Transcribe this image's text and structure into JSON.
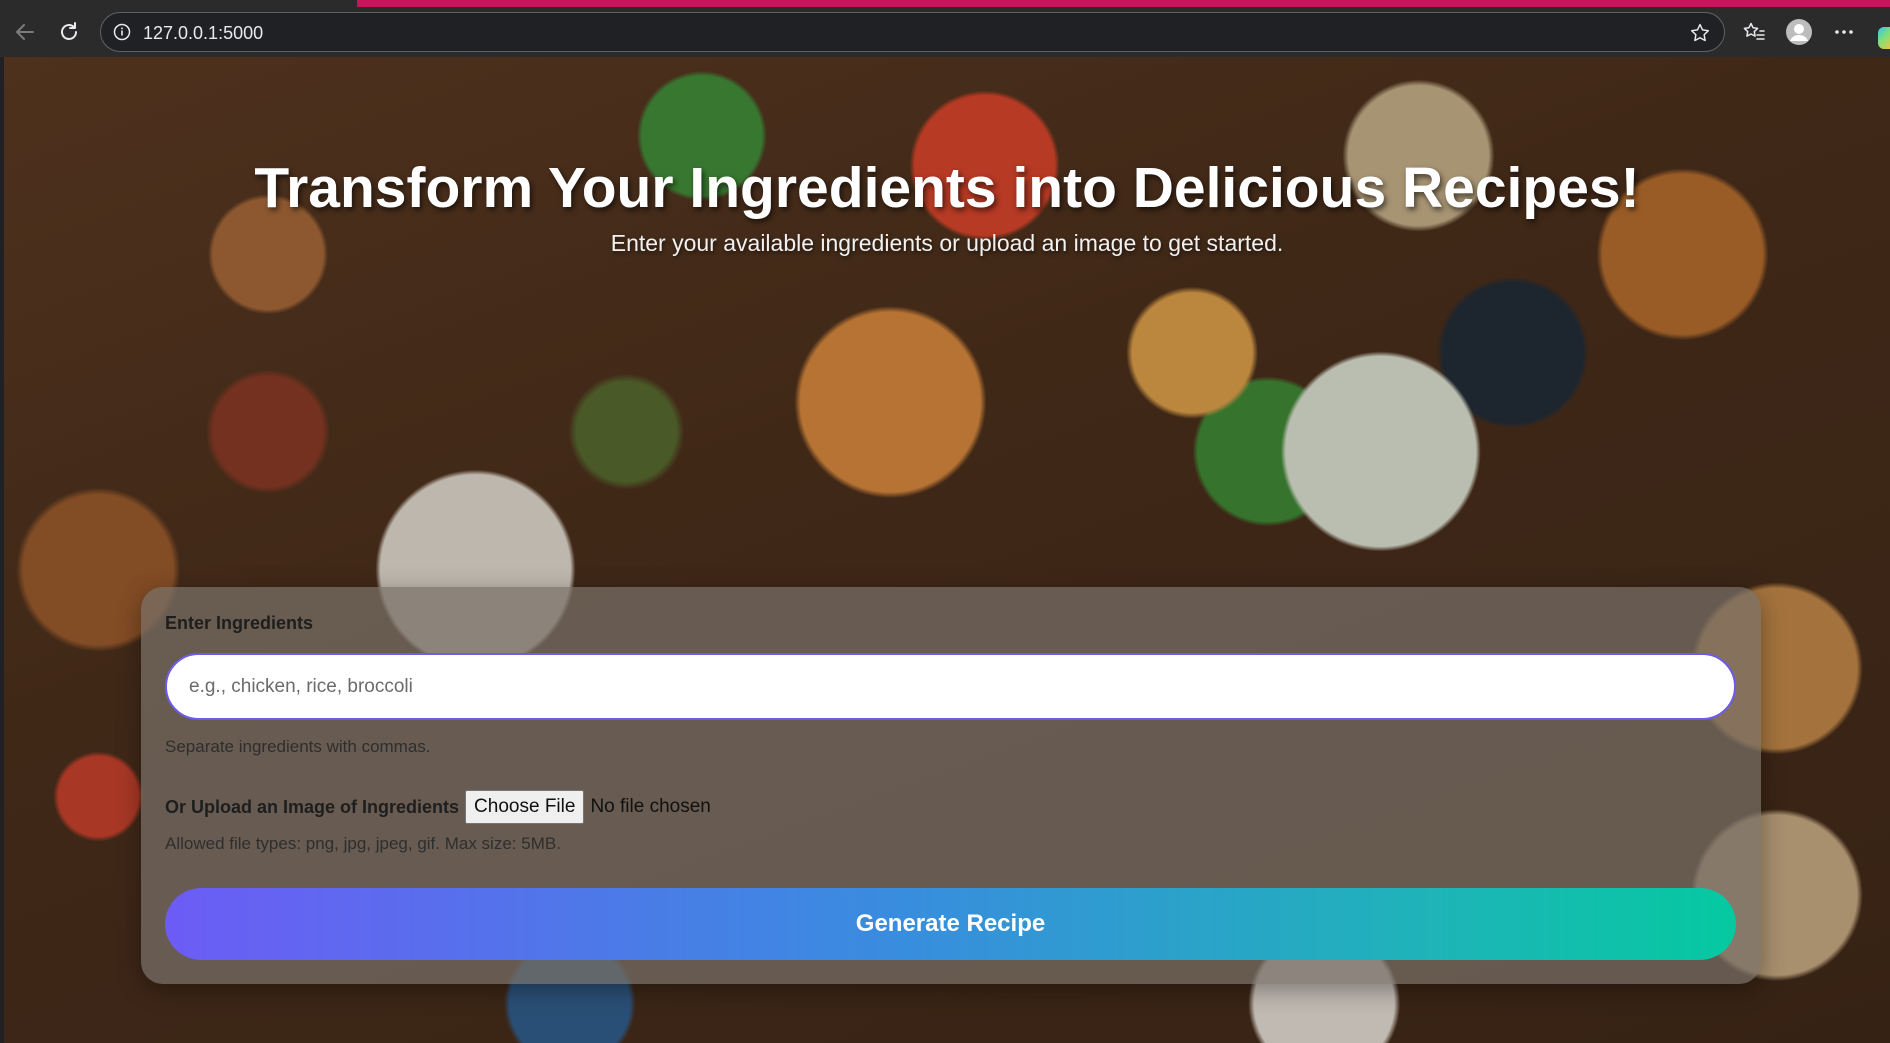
{
  "browser": {
    "url": "127.0.0.1:5000",
    "icons": {
      "back": "back-arrow-icon",
      "reload": "reload-icon",
      "site_info": "info-icon",
      "favorite": "star-icon",
      "favorites": "favorites-icon",
      "profile": "profile-icon",
      "menu": "more-icon",
      "copilot": "copilot-icon"
    },
    "accent_color": "#c2185b"
  },
  "hero": {
    "title": "Transform Your Ingredients into Delicious Recipes!",
    "subtitle": "Enter your available ingredients or upload an image to get started."
  },
  "form": {
    "ingredients_label": "Enter Ingredients",
    "ingredients_value": "",
    "ingredients_placeholder": "e.g., chicken, rice, broccoli",
    "ingredients_help": "Separate ingredients with commas.",
    "upload_label": "Or Upload an Image of Ingredients",
    "choose_file_label": "Choose File",
    "file_status": "No file chosen",
    "upload_help": "Allowed file types: png, jpg, jpeg, gif. Max size: 5MB.",
    "submit_label": "Generate Recipe",
    "input_border_color": "#6c5ce7",
    "button_gradient": [
      "#6c5cf5",
      "#3a8be0",
      "#05c9a0"
    ]
  }
}
